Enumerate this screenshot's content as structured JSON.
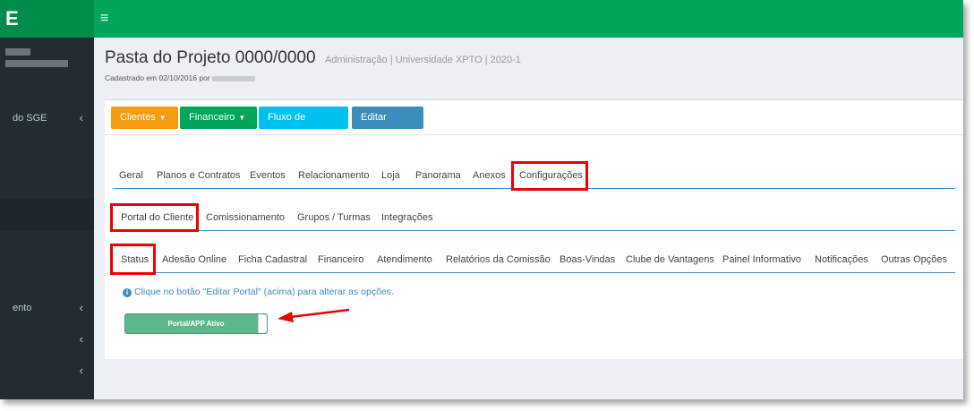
{
  "app": {
    "logo": "E",
    "menu_icon": "hamburger-icon"
  },
  "sidebar": {
    "items": [
      {
        "label": "do SGE",
        "chevron": "‹"
      },
      {
        "label": "ento",
        "chevron": "‹"
      },
      {
        "label": "",
        "chevron": "‹"
      },
      {
        "label": "",
        "chevron": "‹"
      }
    ]
  },
  "header": {
    "title": "Pasta do Projeto 0000/0000",
    "subtitle": "Administração | Universidade XPTO | 2020-1",
    "registered": "Cadastrado em 02/10/2016 por"
  },
  "toolbar": {
    "clientes": "Clientes",
    "financeiro": "Financeiro",
    "fluxo": "Fluxo de trabalho",
    "editar": "Editar Portal",
    "caret": "▼"
  },
  "tabs": {
    "main": [
      "Geral",
      "Planos e Contratos",
      "Eventos",
      "Relacionamento",
      "Loja",
      "Panorama",
      "Anexos",
      "Configurações"
    ],
    "sub": [
      "Portal do Cliente",
      "Comissionamento",
      "Grupos / Turmas",
      "Integrações"
    ],
    "portal": [
      "Status",
      "Adesão Online",
      "Ficha Cadastral",
      "Financeiro",
      "Atendimento",
      "Relatórios da Comissão",
      "Boas-Vindas",
      "Clube de Vantagens",
      "Painel Informativo",
      "Notificações",
      "Outras Opções"
    ]
  },
  "info": {
    "icon": "i",
    "text": "Clique no botão \"Editar Portal\" (acima) para alterar as opções."
  },
  "toggle": {
    "label": "Portal/APP Ativo",
    "state": "on"
  },
  "colors": {
    "brand": "#00a65a",
    "sidebar": "#222d32",
    "highlight": "#e00000"
  }
}
